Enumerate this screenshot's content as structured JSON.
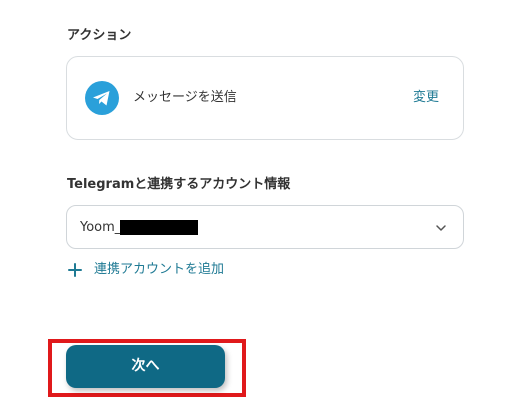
{
  "action_section": {
    "label": "アクション",
    "action_name": "メッセージを送信",
    "change_label": "変更",
    "icon": "telegram-icon"
  },
  "account_section": {
    "label": "Telegramと連携するアカウント情報",
    "selected_account": "Yoom_",
    "add_account_label": "連携アカウントを追加"
  },
  "footer": {
    "next_label": "次へ"
  },
  "colors": {
    "accent": "#1f7a94",
    "primary_button": "#0f6985",
    "telegram_blue": "#2aa0da",
    "highlight_red": "#e0191b"
  }
}
